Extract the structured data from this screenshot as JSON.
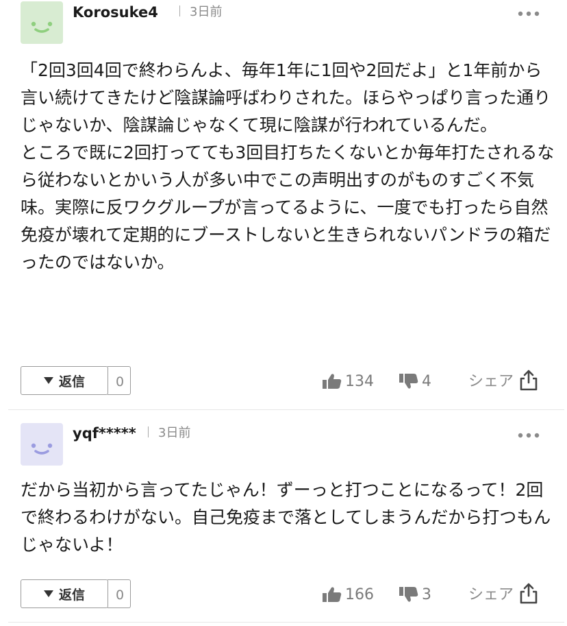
{
  "comments": [
    {
      "author": "Korosuke4",
      "time": "3日前",
      "avatar_color": "#d8ecd2",
      "avatar_face_color": "#8fcf7f",
      "avatar_icon": "smiley-face-icon",
      "paragraphs": [
        "「2回3回4回で終わらんよ、毎年1年に1回や2回だよ」と1年前から言い続けてきたけど陰謀論呼ばわりされた。ほらやっぱり言った通りじゃないか、陰謀論じゃなくて現に陰謀が行われているんだ。",
        "ところで既に2回打ってても3回目打ちたくないとか毎年打たされるなら従わないとかいう人が多い中でこの声明出すのがものすごく不気味。実際に反ワクグループが言ってるように、一度でも打ったら自然免疫が壊れて定期的にブーストしないと生きられないパンドラの箱だったのではないか。"
      ],
      "reply_label": "返信",
      "reply_count": "0",
      "likes": "134",
      "dislikes": "4",
      "share_label": "シェア"
    },
    {
      "author": "yqf*****",
      "time": "3日前",
      "avatar_color": "#e4e4f6",
      "avatar_face_color": "#9b9ce0",
      "avatar_icon": "smiley-face-icon",
      "paragraphs": [
        "だから当初から言ってたじゃん！ずーっと打つことになるって！2回で終わるわけがない。自己免疫まで落としてしまうんだから打つもんじゃないよ！"
      ],
      "reply_label": "返信",
      "reply_count": "0",
      "likes": "166",
      "dislikes": "3",
      "share_label": "シェア"
    }
  ]
}
